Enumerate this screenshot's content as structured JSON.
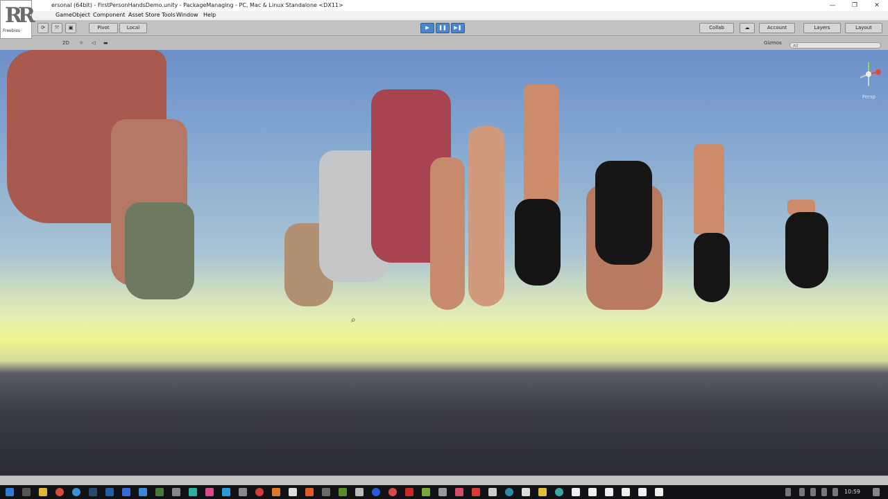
{
  "window": {
    "title": "ersonal (64bit) - FirstPersonHandsDemo.unity - PackageManaging - PC, Mac & Linux Standalone <DX11>",
    "minimize": "—",
    "restore": "❐",
    "close": "✕"
  },
  "logo": {
    "text": "Freebies"
  },
  "menu": [
    "GameObject",
    "Component",
    "Asset Store Tools",
    "Window",
    "Help"
  ],
  "toolbar": {
    "pivot": "Pivot",
    "local": "Local",
    "collab": "Collab",
    "account": "Account",
    "layers": "Layers",
    "layout": "Layout"
  },
  "scene": {
    "mode_2d": "2D",
    "gizmos": "Gizmos",
    "search_placeholder": "All",
    "persp": "Persp"
  },
  "taskbar": {
    "time": "10:59"
  },
  "colors": {
    "play_active": "#4a86c8",
    "sky_top": "#6d8fc9",
    "horizon": "#f0f48f",
    "ground": "#2b2c34"
  }
}
